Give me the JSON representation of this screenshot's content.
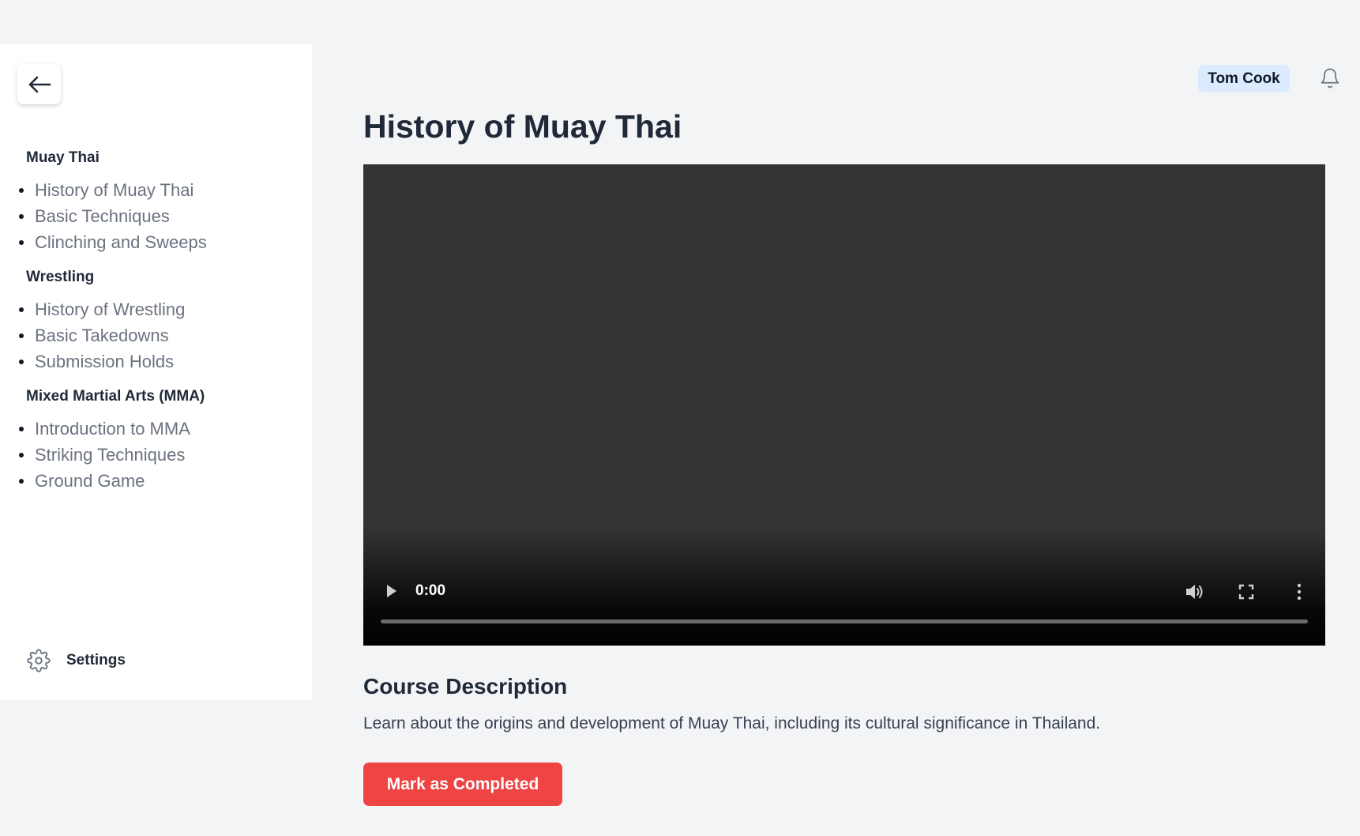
{
  "sidebar": {
    "back_icon": "arrow-left-icon",
    "sections": [
      {
        "title": "Muay Thai",
        "items": [
          "History of Muay Thai",
          "Basic Techniques",
          "Clinching and Sweeps"
        ]
      },
      {
        "title": "Wrestling",
        "items": [
          "History of Wrestling",
          "Basic Takedowns",
          "Submission Holds"
        ]
      },
      {
        "title": "Mixed Martial Arts (MMA)",
        "items": [
          "Introduction to MMA",
          "Striking Techniques",
          "Ground Game"
        ]
      }
    ],
    "settings": {
      "icon": "gear-icon",
      "label": "Settings"
    }
  },
  "header": {
    "user_name": "Tom Cook",
    "notification_icon": "bell-icon"
  },
  "main": {
    "title": "History of Muay Thai",
    "video": {
      "current_time": "0:00",
      "progress": 0
    },
    "description_heading": "Course Description",
    "description_text": "Learn about the origins and development of Muay Thai, including its cultural significance in Thailand.",
    "complete_button_label": "Mark as Completed"
  },
  "colors": {
    "page_background": "#f3f4f6",
    "sidebar_background": "#ffffff",
    "user_badge_background": "#dbeafe",
    "video_background": "#333333",
    "primary_button": "#ef4444"
  }
}
